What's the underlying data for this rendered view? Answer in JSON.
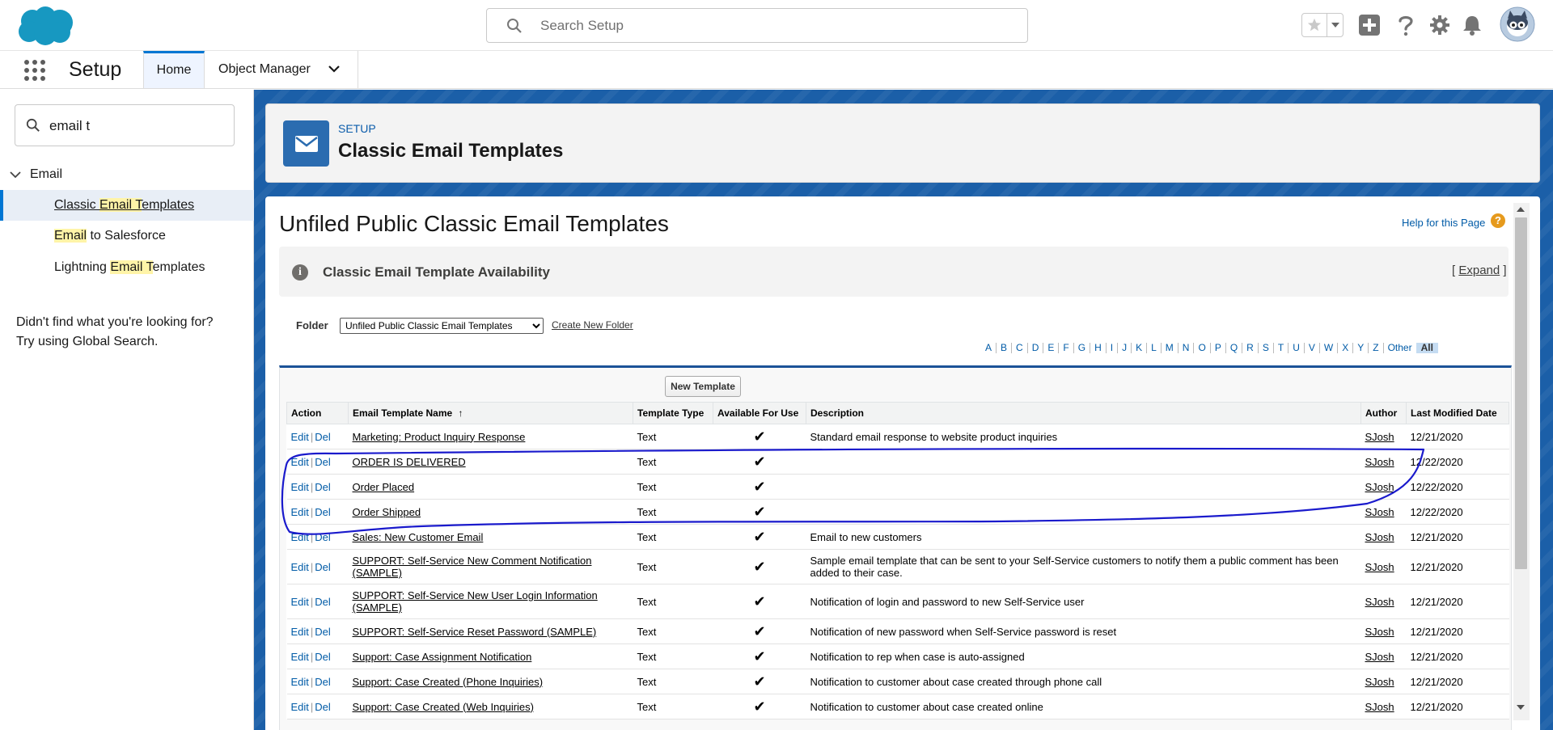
{
  "header": {
    "search_placeholder": "Search Setup"
  },
  "context_bar": {
    "app_name": "Setup",
    "tabs": [
      {
        "label": "Home"
      },
      {
        "label": "Object Manager"
      }
    ]
  },
  "sidebar": {
    "quickfind_value": "email t",
    "group_label": "Email",
    "items": [
      {
        "pre": "Classic ",
        "hl": "Email",
        "mid": " T",
        "post": "emplates"
      },
      {
        "pre": "",
        "hl": "Email",
        "mid": "",
        "post": " to Salesforce"
      },
      {
        "pre": "Lightning ",
        "hl": "Email",
        "mid": " T",
        "post": "emplates"
      }
    ],
    "help_line1": "Didn't find what you're looking for?",
    "help_line2": "Try using Global Search."
  },
  "page_header": {
    "eyebrow": "SETUP",
    "title": "Classic Email Templates"
  },
  "content": {
    "title": "Unfiled Public Classic Email Templates",
    "help_link": "Help for this Page",
    "help_icon": "?",
    "availability_title": "Classic Email Template Availability",
    "expand_open": "[ ",
    "expand_label": "Expand",
    "expand_close": " ]",
    "folder_label": "Folder",
    "folder_selected": "Unfiled Public Classic Email Templates",
    "create_folder": "Create New Folder",
    "alphabet": [
      "A",
      "B",
      "C",
      "D",
      "E",
      "F",
      "G",
      "H",
      "I",
      "J",
      "K",
      "L",
      "M",
      "N",
      "O",
      "P",
      "Q",
      "R",
      "S",
      "T",
      "U",
      "V",
      "W",
      "X",
      "Y",
      "Z",
      "Other",
      "All"
    ],
    "alphabet_selected": "All",
    "new_template_button": "New Template"
  },
  "table": {
    "columns": [
      "Action",
      "Email Template Name",
      "Template Type",
      "Available For Use",
      "Description",
      "Author",
      "Last Modified Date"
    ],
    "sort_indicator": "↑",
    "edit_label": "Edit",
    "del_label": "Del",
    "rows": [
      {
        "name": "Marketing: Product Inquiry Response",
        "type": "Text",
        "available": "✔",
        "description": "Standard email response to website product inquiries",
        "author": "SJosh",
        "modified": "12/21/2020"
      },
      {
        "name": "ORDER IS DELIVERED",
        "type": "Text",
        "available": "✔",
        "description": "",
        "author": "SJosh",
        "modified": "12/22/2020"
      },
      {
        "name": "Order Placed",
        "type": "Text",
        "available": "✔",
        "description": "",
        "author": "SJosh",
        "modified": "12/22/2020"
      },
      {
        "name": "Order Shipped",
        "type": "Text",
        "available": "✔",
        "description": "",
        "author": "SJosh",
        "modified": "12/22/2020"
      },
      {
        "name": "Sales: New Customer Email",
        "type": "Text",
        "available": "✔",
        "description": "Email to new customers",
        "author": "SJosh",
        "modified": "12/21/2020"
      },
      {
        "name": "SUPPORT: Self-Service New Comment Notification (SAMPLE)",
        "type": "Text",
        "available": "✔",
        "description": "Sample email template that can be sent to your Self-Service customers to notify them a public comment has been added to their case.",
        "author": "SJosh",
        "modified": "12/21/2020"
      },
      {
        "name": "SUPPORT: Self-Service New User Login Information (SAMPLE)",
        "type": "Text",
        "available": "✔",
        "description": "Notification of login and password to new Self-Service user",
        "author": "SJosh",
        "modified": "12/21/2020"
      },
      {
        "name": "SUPPORT: Self-Service Reset Password (SAMPLE)",
        "type": "Text",
        "available": "✔",
        "description": "Notification of new password when Self-Service password is reset",
        "author": "SJosh",
        "modified": "12/21/2020"
      },
      {
        "name": "Support: Case Assignment Notification",
        "type": "Text",
        "available": "✔",
        "description": "Notification to rep when case is auto-assigned",
        "author": "SJosh",
        "modified": "12/21/2020"
      },
      {
        "name": "Support: Case Created (Phone Inquiries)",
        "type": "Text",
        "available": "✔",
        "description": "Notification to customer about case created through phone call",
        "author": "SJosh",
        "modified": "12/21/2020"
      },
      {
        "name": "Support: Case Created (Web Inquiries)",
        "type": "Text",
        "available": "✔",
        "description": "Notification to customer about case created online",
        "author": "SJosh",
        "modified": "12/21/2020"
      }
    ]
  },
  "colors": {
    "brand": "#1798c1",
    "accent": "#0176d3",
    "annotation": "#1a1acc"
  },
  "icons": [
    "salesforce-cloud-icon",
    "search-icon",
    "star-icon",
    "plus-icon",
    "help-icon",
    "gear-icon",
    "bell-icon",
    "avatar",
    "app-launcher-icon",
    "chevron-down-icon",
    "email-icon",
    "info-icon"
  ]
}
